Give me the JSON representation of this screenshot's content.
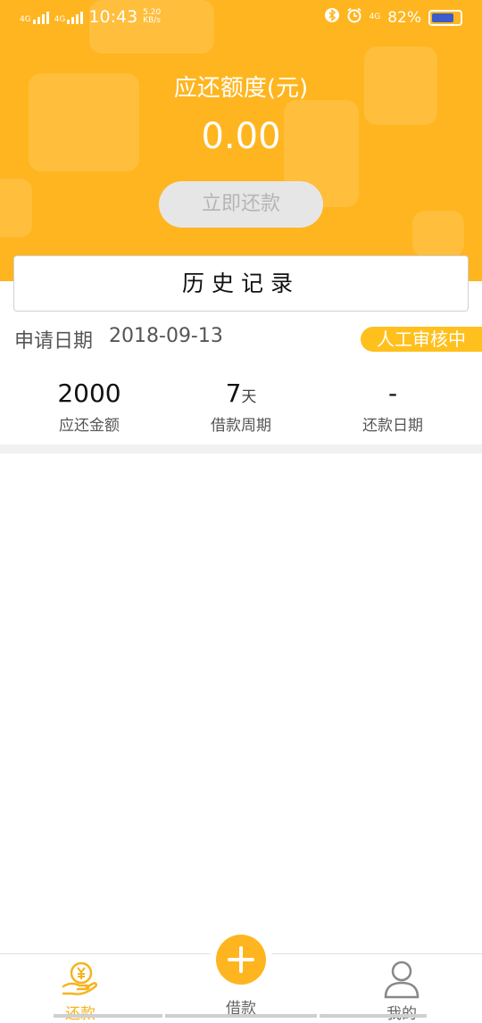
{
  "status_bar": {
    "network_1": "4G",
    "network_2": "4G",
    "time": "10:43",
    "speed_value": "5.20",
    "speed_unit": "KB/s",
    "network_3": "4G",
    "battery": "82%"
  },
  "header": {
    "title": "应还额度(元)",
    "amount": "0.00",
    "repay_button": "立即还款",
    "history_button": "历史记录"
  },
  "record": {
    "date_label": "申请日期",
    "date_value": "2018-09-13",
    "status_badge": "人工审核中",
    "amount_value": "2000",
    "amount_label": "应还金额",
    "period_value": "7",
    "period_unit": "天",
    "period_label": "借款周期",
    "repay_date_value": "-",
    "repay_date_label": "还款日期"
  },
  "tabbar": {
    "tabs": [
      {
        "label": "还款",
        "icon": "repay-hand-yen-icon",
        "active": true
      },
      {
        "label": "借款",
        "icon": "plus-icon",
        "active": false
      },
      {
        "label": "我的",
        "icon": "user-icon",
        "active": false
      }
    ],
    "active_color": "#f5b41e",
    "inactive_color": "#666666"
  },
  "colors": {
    "accent": "#ffb51f",
    "badge": "#ffc01e",
    "disabled_button": "#e6e6e6"
  }
}
